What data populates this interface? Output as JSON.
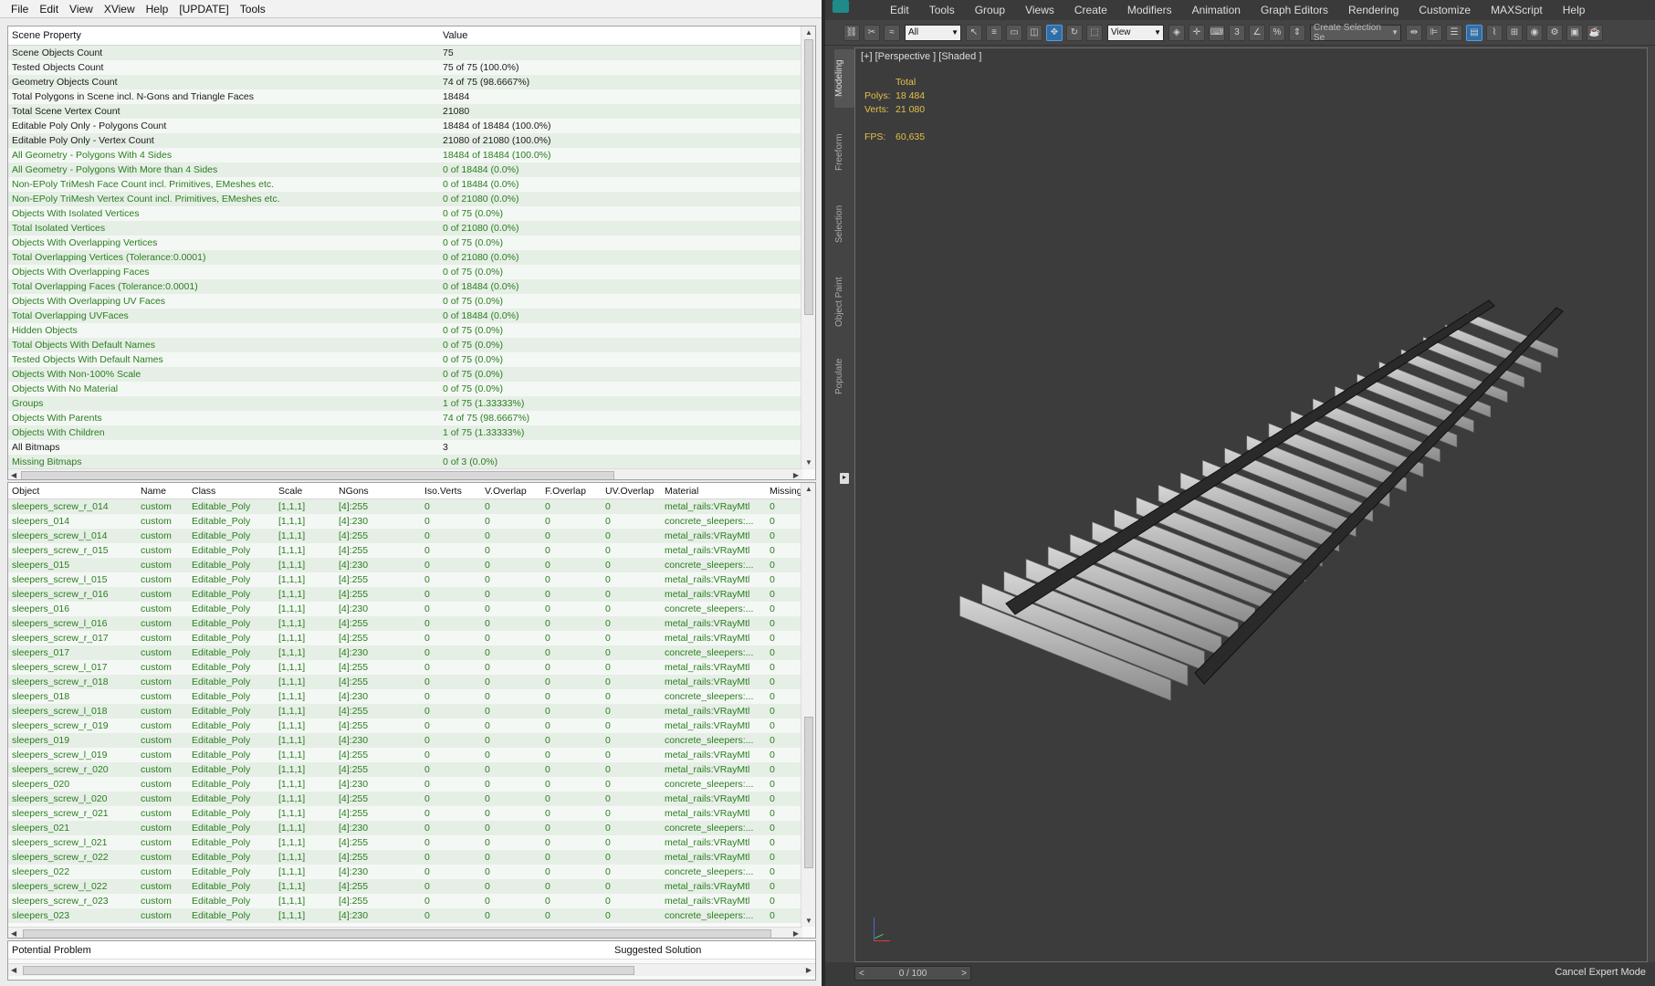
{
  "left_menu": [
    "File",
    "Edit",
    "View",
    "XView",
    "Help",
    "[UPDATE]",
    "Tools"
  ],
  "props": {
    "header": {
      "property": "Scene Property",
      "value": "Value"
    },
    "rows": [
      {
        "p": "Scene Objects Count",
        "v": "75",
        "g": false
      },
      {
        "p": "Tested Objects Count",
        "v": "75 of 75 (100.0%)",
        "g": false
      },
      {
        "p": "Geometry Objects Count",
        "v": "74 of 75 (98.6667%)",
        "g": false
      },
      {
        "p": "Total Polygons in Scene incl. N-Gons and Triangle Faces",
        "v": "18484",
        "g": false
      },
      {
        "p": "Total Scene Vertex Count",
        "v": "21080",
        "g": false
      },
      {
        "p": "Editable Poly Only - Polygons Count",
        "v": "18484 of 18484 (100.0%)",
        "g": false
      },
      {
        "p": "Editable Poly Only - Vertex Count",
        "v": "21080 of 21080 (100.0%)",
        "g": false
      },
      {
        "p": "All Geometry - Polygons With 4 Sides",
        "v": "18484 of 18484 (100.0%)",
        "g": true
      },
      {
        "p": "All Geometry - Polygons With More than 4 Sides",
        "v": "0 of 18484 (0.0%)",
        "g": true
      },
      {
        "p": "Non-EPoly TriMesh Face Count incl. Primitives, EMeshes etc.",
        "v": "0 of 18484 (0.0%)",
        "g": true
      },
      {
        "p": "Non-EPoly TriMesh Vertex Count incl. Primitives, EMeshes etc.",
        "v": "0 of 21080 (0.0%)",
        "g": true
      },
      {
        "p": "Objects With Isolated Vertices",
        "v": "0 of 75 (0.0%)",
        "g": true
      },
      {
        "p": "Total Isolated Vertices",
        "v": "0 of 21080 (0.0%)",
        "g": true
      },
      {
        "p": "Objects With Overlapping Vertices",
        "v": "0 of 75 (0.0%)",
        "g": true
      },
      {
        "p": "Total Overlapping Vertices (Tolerance:0.0001)",
        "v": "0 of 21080 (0.0%)",
        "g": true
      },
      {
        "p": "Objects With Overlapping Faces",
        "v": "0 of 75 (0.0%)",
        "g": true
      },
      {
        "p": "Total Overlapping Faces (Tolerance:0.0001)",
        "v": "0 of 18484 (0.0%)",
        "g": true
      },
      {
        "p": "Objects With Overlapping UV Faces",
        "v": "0 of 75 (0.0%)",
        "g": true
      },
      {
        "p": "Total Overlapping UVFaces",
        "v": "0 of 18484 (0.0%)",
        "g": true
      },
      {
        "p": "Hidden Objects",
        "v": "0 of 75 (0.0%)",
        "g": true
      },
      {
        "p": "Total Objects With Default Names",
        "v": "0 of 75 (0.0%)",
        "g": true
      },
      {
        "p": "Tested Objects With Default Names",
        "v": "0 of 75 (0.0%)",
        "g": true
      },
      {
        "p": "Objects With Non-100% Scale",
        "v": "0 of 75 (0.0%)",
        "g": true
      },
      {
        "p": "Objects With No Material",
        "v": "0 of 75 (0.0%)",
        "g": true
      },
      {
        "p": "Groups",
        "v": "1 of 75 (1.33333%)",
        "g": true
      },
      {
        "p": "Objects With Parents",
        "v": "74 of 75 (98.6667%)",
        "g": true
      },
      {
        "p": "Objects With Children",
        "v": "1 of 75 (1.33333%)",
        "g": true
      },
      {
        "p": "All Bitmaps",
        "v": "3",
        "g": false
      },
      {
        "p": "Missing Bitmaps",
        "v": "0 of 3 (0.0%)",
        "g": true
      }
    ]
  },
  "objects": {
    "columns": [
      "Object",
      "Name",
      "Class",
      "Scale",
      "NGons",
      "Iso.Verts",
      "V.Overlap",
      "F.Overlap",
      "UV.Overlap",
      "Material",
      "Missing"
    ],
    "rows": [
      [
        "sleepers_screw_r_014",
        "custom",
        "Editable_Poly",
        "[1,1,1]",
        "[4]:255",
        "0",
        "0",
        "0",
        "0",
        "metal_rails:VRayMtl",
        "0"
      ],
      [
        "sleepers_014",
        "custom",
        "Editable_Poly",
        "[1,1,1]",
        "[4]:230",
        "0",
        "0",
        "0",
        "0",
        "concrete_sleepers:...",
        "0"
      ],
      [
        "sleepers_screw_l_014",
        "custom",
        "Editable_Poly",
        "[1,1,1]",
        "[4]:255",
        "0",
        "0",
        "0",
        "0",
        "metal_rails:VRayMtl",
        "0"
      ],
      [
        "sleepers_screw_r_015",
        "custom",
        "Editable_Poly",
        "[1,1,1]",
        "[4]:255",
        "0",
        "0",
        "0",
        "0",
        "metal_rails:VRayMtl",
        "0"
      ],
      [
        "sleepers_015",
        "custom",
        "Editable_Poly",
        "[1,1,1]",
        "[4]:230",
        "0",
        "0",
        "0",
        "0",
        "concrete_sleepers:...",
        "0"
      ],
      [
        "sleepers_screw_l_015",
        "custom",
        "Editable_Poly",
        "[1,1,1]",
        "[4]:255",
        "0",
        "0",
        "0",
        "0",
        "metal_rails:VRayMtl",
        "0"
      ],
      [
        "sleepers_screw_r_016",
        "custom",
        "Editable_Poly",
        "[1,1,1]",
        "[4]:255",
        "0",
        "0",
        "0",
        "0",
        "metal_rails:VRayMtl",
        "0"
      ],
      [
        "sleepers_016",
        "custom",
        "Editable_Poly",
        "[1,1,1]",
        "[4]:230",
        "0",
        "0",
        "0",
        "0",
        "concrete_sleepers:...",
        "0"
      ],
      [
        "sleepers_screw_l_016",
        "custom",
        "Editable_Poly",
        "[1,1,1]",
        "[4]:255",
        "0",
        "0",
        "0",
        "0",
        "metal_rails:VRayMtl",
        "0"
      ],
      [
        "sleepers_screw_r_017",
        "custom",
        "Editable_Poly",
        "[1,1,1]",
        "[4]:255",
        "0",
        "0",
        "0",
        "0",
        "metal_rails:VRayMtl",
        "0"
      ],
      [
        "sleepers_017",
        "custom",
        "Editable_Poly",
        "[1,1,1]",
        "[4]:230",
        "0",
        "0",
        "0",
        "0",
        "concrete_sleepers:...",
        "0"
      ],
      [
        "sleepers_screw_l_017",
        "custom",
        "Editable_Poly",
        "[1,1,1]",
        "[4]:255",
        "0",
        "0",
        "0",
        "0",
        "metal_rails:VRayMtl",
        "0"
      ],
      [
        "sleepers_screw_r_018",
        "custom",
        "Editable_Poly",
        "[1,1,1]",
        "[4]:255",
        "0",
        "0",
        "0",
        "0",
        "metal_rails:VRayMtl",
        "0"
      ],
      [
        "sleepers_018",
        "custom",
        "Editable_Poly",
        "[1,1,1]",
        "[4]:230",
        "0",
        "0",
        "0",
        "0",
        "concrete_sleepers:...",
        "0"
      ],
      [
        "sleepers_screw_l_018",
        "custom",
        "Editable_Poly",
        "[1,1,1]",
        "[4]:255",
        "0",
        "0",
        "0",
        "0",
        "metal_rails:VRayMtl",
        "0"
      ],
      [
        "sleepers_screw_r_019",
        "custom",
        "Editable_Poly",
        "[1,1,1]",
        "[4]:255",
        "0",
        "0",
        "0",
        "0",
        "metal_rails:VRayMtl",
        "0"
      ],
      [
        "sleepers_019",
        "custom",
        "Editable_Poly",
        "[1,1,1]",
        "[4]:230",
        "0",
        "0",
        "0",
        "0",
        "concrete_sleepers:...",
        "0"
      ],
      [
        "sleepers_screw_l_019",
        "custom",
        "Editable_Poly",
        "[1,1,1]",
        "[4]:255",
        "0",
        "0",
        "0",
        "0",
        "metal_rails:VRayMtl",
        "0"
      ],
      [
        "sleepers_screw_r_020",
        "custom",
        "Editable_Poly",
        "[1,1,1]",
        "[4]:255",
        "0",
        "0",
        "0",
        "0",
        "metal_rails:VRayMtl",
        "0"
      ],
      [
        "sleepers_020",
        "custom",
        "Editable_Poly",
        "[1,1,1]",
        "[4]:230",
        "0",
        "0",
        "0",
        "0",
        "concrete_sleepers:...",
        "0"
      ],
      [
        "sleepers_screw_l_020",
        "custom",
        "Editable_Poly",
        "[1,1,1]",
        "[4]:255",
        "0",
        "0",
        "0",
        "0",
        "metal_rails:VRayMtl",
        "0"
      ],
      [
        "sleepers_screw_r_021",
        "custom",
        "Editable_Poly",
        "[1,1,1]",
        "[4]:255",
        "0",
        "0",
        "0",
        "0",
        "metal_rails:VRayMtl",
        "0"
      ],
      [
        "sleepers_021",
        "custom",
        "Editable_Poly",
        "[1,1,1]",
        "[4]:230",
        "0",
        "0",
        "0",
        "0",
        "concrete_sleepers:...",
        "0"
      ],
      [
        "sleepers_screw_l_021",
        "custom",
        "Editable_Poly",
        "[1,1,1]",
        "[4]:255",
        "0",
        "0",
        "0",
        "0",
        "metal_rails:VRayMtl",
        "0"
      ],
      [
        "sleepers_screw_r_022",
        "custom",
        "Editable_Poly",
        "[1,1,1]",
        "[4]:255",
        "0",
        "0",
        "0",
        "0",
        "metal_rails:VRayMtl",
        "0"
      ],
      [
        "sleepers_022",
        "custom",
        "Editable_Poly",
        "[1,1,1]",
        "[4]:230",
        "0",
        "0",
        "0",
        "0",
        "concrete_sleepers:...",
        "0"
      ],
      [
        "sleepers_screw_l_022",
        "custom",
        "Editable_Poly",
        "[1,1,1]",
        "[4]:255",
        "0",
        "0",
        "0",
        "0",
        "metal_rails:VRayMtl",
        "0"
      ],
      [
        "sleepers_screw_r_023",
        "custom",
        "Editable_Poly",
        "[1,1,1]",
        "[4]:255",
        "0",
        "0",
        "0",
        "0",
        "metal_rails:VRayMtl",
        "0"
      ],
      [
        "sleepers_023",
        "custom",
        "Editable_Poly",
        "[1,1,1]",
        "[4]:230",
        "0",
        "0",
        "0",
        "0",
        "concrete_sleepers:...",
        "0"
      ]
    ]
  },
  "problems": {
    "problem_label": "Potential Problem",
    "solution_label": "Suggested Solution"
  },
  "max": {
    "menu": [
      "Edit",
      "Tools",
      "Group",
      "Views",
      "Create",
      "Modifiers",
      "Animation",
      "Graph Editors",
      "Rendering",
      "Customize",
      "MAXScript",
      "Help"
    ],
    "filter_value": "All",
    "refcoord_value": "View",
    "selset_placeholder": "Create Selection Se",
    "side_tabs": [
      "Modeling",
      "Freeform",
      "Selection",
      "Object Paint",
      "Populate"
    ],
    "viewport_label": "[+] [Perspective ] [Shaded ]",
    "stats": {
      "total_label": "Total",
      "polys_label": "Polys:",
      "polys_value": "18 484",
      "verts_label": "Verts:",
      "verts_value": "21 080",
      "fps_label": "FPS:",
      "fps_value": "60,635"
    },
    "time_slider": "0 / 100",
    "cancel_expert": "Cancel Expert Mode",
    "colors": {
      "accent": "#2f6ea8",
      "stats": "#e3c04a",
      "green_text": "#2a7d20"
    }
  }
}
